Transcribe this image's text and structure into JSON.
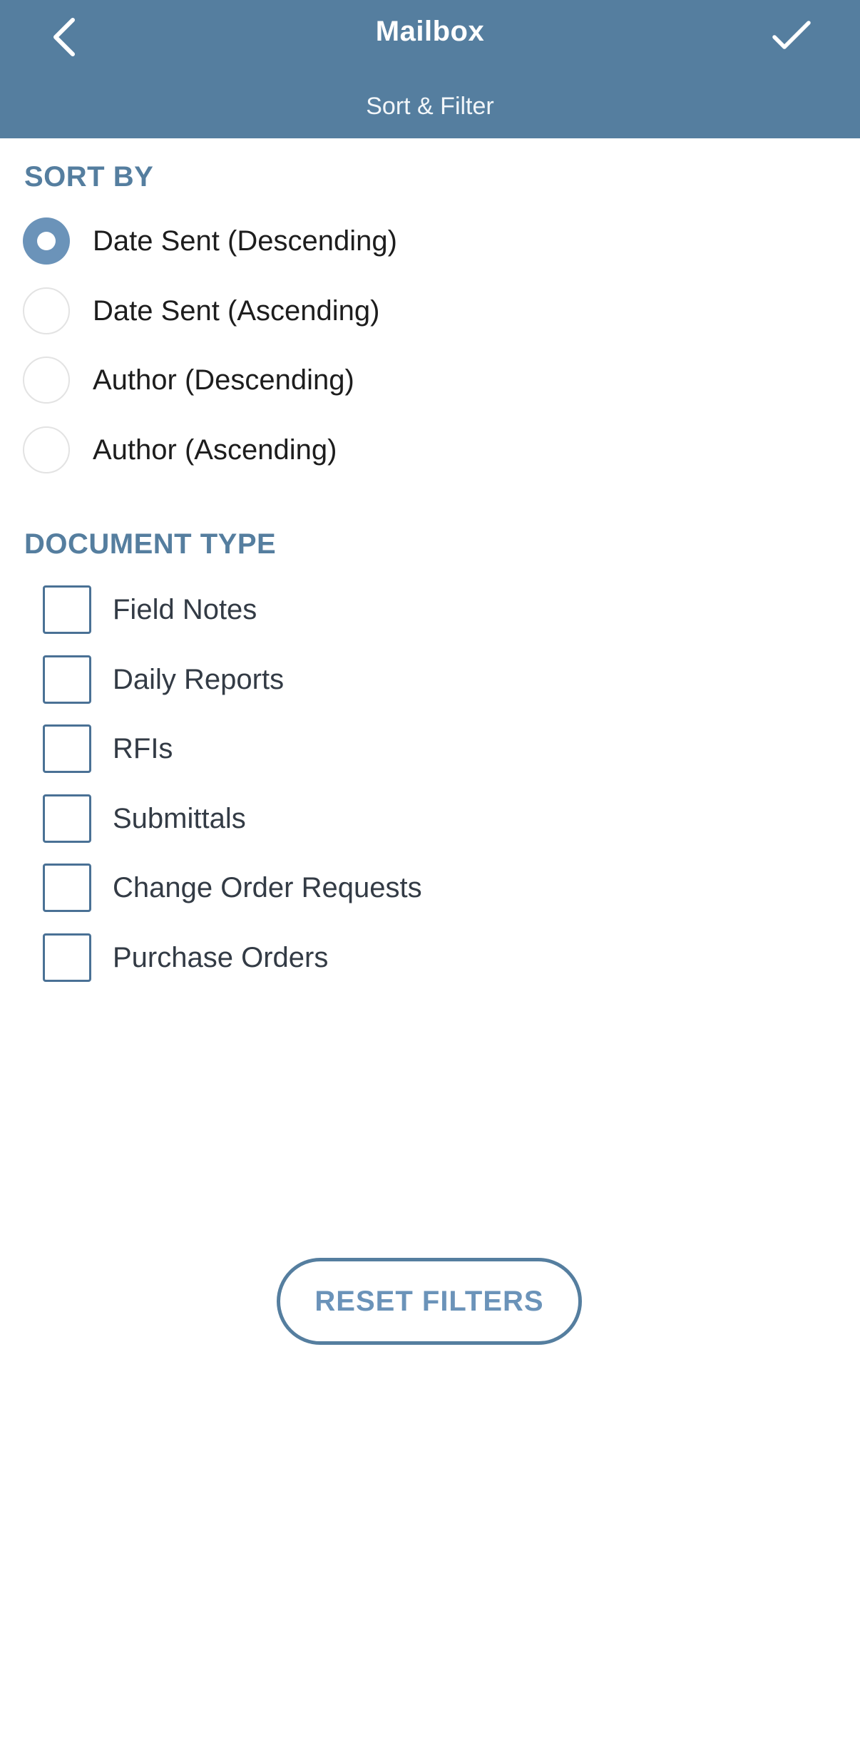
{
  "header": {
    "title": "Mailbox",
    "subtitle": "Sort & Filter",
    "back_icon": "chevron-left-icon",
    "confirm_icon": "checkmark-icon",
    "background_color": "#557e9f"
  },
  "sort_by": {
    "heading": "SORT BY",
    "selected_index": 0,
    "options": [
      {
        "label": "Date Sent (Descending)",
        "selected": true
      },
      {
        "label": "Date Sent (Ascending)",
        "selected": false
      },
      {
        "label": "Author (Descending)",
        "selected": false
      },
      {
        "label": "Author (Ascending)",
        "selected": false
      }
    ]
  },
  "document_type": {
    "heading": "DOCUMENT TYPE",
    "options": [
      {
        "label": "Field Notes",
        "checked": false
      },
      {
        "label": "Daily Reports",
        "checked": false
      },
      {
        "label": "RFIs",
        "checked": false
      },
      {
        "label": "Submittals",
        "checked": false
      },
      {
        "label": "Change Order Requests",
        "checked": false
      },
      {
        "label": "Purchase Orders",
        "checked": false
      }
    ]
  },
  "reset_button": {
    "label": "RESET FILTERS"
  },
  "colors": {
    "accent": "#557e9f",
    "radio_selected": "#6b93b9"
  }
}
